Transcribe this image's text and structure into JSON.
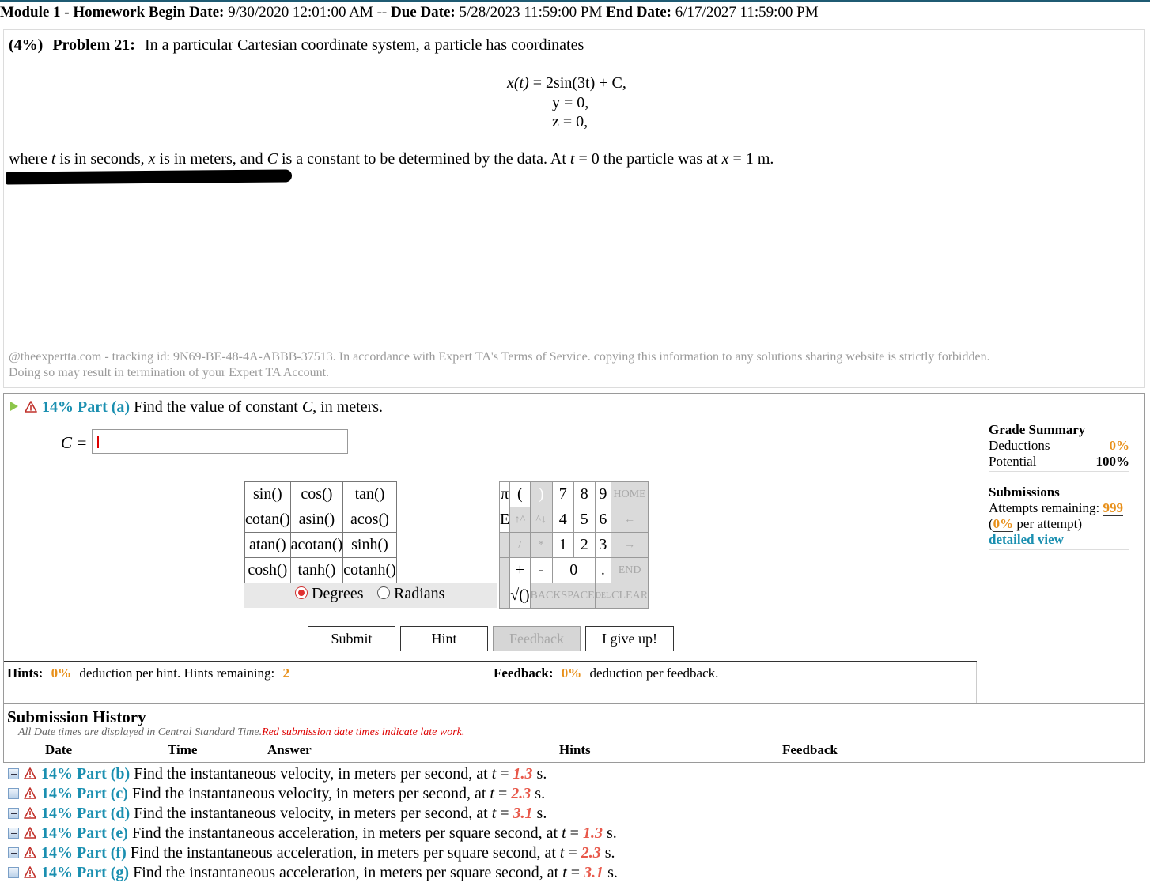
{
  "header": {
    "module": "Module 1 - Homework",
    "begin_label": "Begin Date:",
    "begin_value": "9/30/2020 12:01:00 AM --",
    "due_label": "Due Date:",
    "due_value": "5/28/2023 11:59:00 PM",
    "end_label": "End Date:",
    "end_value": "6/17/2027 11:59:00 PM"
  },
  "problem": {
    "weight": "(4%)",
    "title": "Problem 21:",
    "statement": "In a particular Cartesian coordinate system, a particle has coordinates",
    "eq_x_lhs": "x(t)",
    "eq_x_rhs": "= 2sin(3t) + C,",
    "eq_y": "y = 0,",
    "eq_z": "z = 0,",
    "desc_1": "where",
    "desc_t": "t",
    "desc_2": "is in seconds,",
    "desc_x": "x",
    "desc_3": "is in meters, and",
    "desc_c": "C",
    "desc_4": "is a constant to be determined by the data. At",
    "desc_t2": "t",
    "desc_5": "= 0 the particle was at",
    "desc_x2": "x",
    "desc_6": "= 1 m.",
    "tracking_1": "@theexpertta.com - tracking id: 9N69-BE-48-4A-ABBB-37513. In accordance with Expert TA's Terms of Service. copying this information to any solutions sharing website is strictly forbidden.",
    "tracking_2": "Doing so may result in termination of your Expert TA Account."
  },
  "part_a": {
    "percent_label": "14% Part (a)",
    "question_1": "Find the value of constant",
    "question_c": "C",
    "question_2": ", in meters.",
    "answer_label": "C =",
    "answer_value": ""
  },
  "calculator": {
    "functions": [
      [
        "sin()",
        "cos()",
        "tan()"
      ],
      [
        "cotan()",
        "asin()",
        "acos()"
      ],
      [
        "atan()",
        "acotan()",
        "sinh()"
      ],
      [
        "cosh()",
        "tanh()",
        "cotanh()"
      ]
    ],
    "degrees_label": "Degrees",
    "radians_label": "Radians",
    "pi": "π",
    "e": "E",
    "open_paren": "(",
    "close_paren": ")",
    "up_arrow": "↑^",
    "down_arrow": "^↓",
    "slash": "/",
    "star": "*",
    "plus": "+",
    "minus": "-",
    "sqrt": "√()",
    "dot": ".",
    "digits": [
      "7",
      "8",
      "9",
      "4",
      "5",
      "6",
      "1",
      "2",
      "3",
      "0"
    ],
    "home": "HOME",
    "left": "←",
    "right": "→",
    "end": "END",
    "backspace": "BACKSPACE",
    "del": "DEL",
    "clear": "CLEAR"
  },
  "buttons": {
    "submit": "Submit",
    "hint": "Hint",
    "feedback": "Feedback",
    "give_up": "I give up!"
  },
  "hints": {
    "label": "Hints:",
    "deduction": "0%",
    "text": "deduction per hint. Hints remaining:",
    "remaining": "2"
  },
  "feedback": {
    "label": "Feedback:",
    "deduction": "0%",
    "text": "deduction per feedback."
  },
  "grade_summary": {
    "title": "Grade Summary",
    "deductions_label": "Deductions",
    "deductions_value": "0%",
    "potential_label": "Potential",
    "potential_value": "100%",
    "submissions_title": "Submissions",
    "attempts_label": "Attempts remaining:",
    "attempts_value": "999",
    "per_attempt_value": "0%",
    "per_attempt_label": "per attempt)",
    "open_paren": "(",
    "detailed_view": "detailed view"
  },
  "history": {
    "title": "Submission History",
    "note": "All Date times are displayed in Central Standard Time.",
    "note_red": "Red submission date times indicate late work.",
    "columns": [
      "Date",
      "Time",
      "Answer",
      "Hints",
      "Feedback"
    ]
  },
  "parts": [
    {
      "label": "14% Part (b)",
      "text": "Find the instantaneous velocity, in meters per second, at",
      "var": "t",
      "eq": "=",
      "value": "1.3",
      "unit": "s."
    },
    {
      "label": "14% Part (c)",
      "text": "Find the instantaneous velocity, in meters per second, at",
      "var": "t",
      "eq": "=",
      "value": "2.3",
      "unit": "s."
    },
    {
      "label": "14% Part (d)",
      "text": "Find the instantaneous velocity, in meters per second, at",
      "var": "t",
      "eq": "=",
      "value": "3.1",
      "unit": "s."
    },
    {
      "label": "14% Part (e)",
      "text": "Find the instantaneous acceleration, in meters per square second, at",
      "var": "t",
      "eq": "=",
      "value": "1.3",
      "unit": "s."
    },
    {
      "label": "14% Part (f)",
      "text": "Find the instantaneous acceleration, in meters per square second, at",
      "var": "t",
      "eq": "=",
      "value": "2.3",
      "unit": "s."
    },
    {
      "label": "14% Part (g)",
      "text": "Find the instantaneous acceleration, in meters per square second, at",
      "var": "t",
      "eq": "=",
      "value": "3.1",
      "unit": "s."
    }
  ],
  "colors": {
    "accent": "#1a8fb0",
    "orange": "#e8901a",
    "late_red": "#dd0000",
    "value_red": "#e8584a"
  }
}
